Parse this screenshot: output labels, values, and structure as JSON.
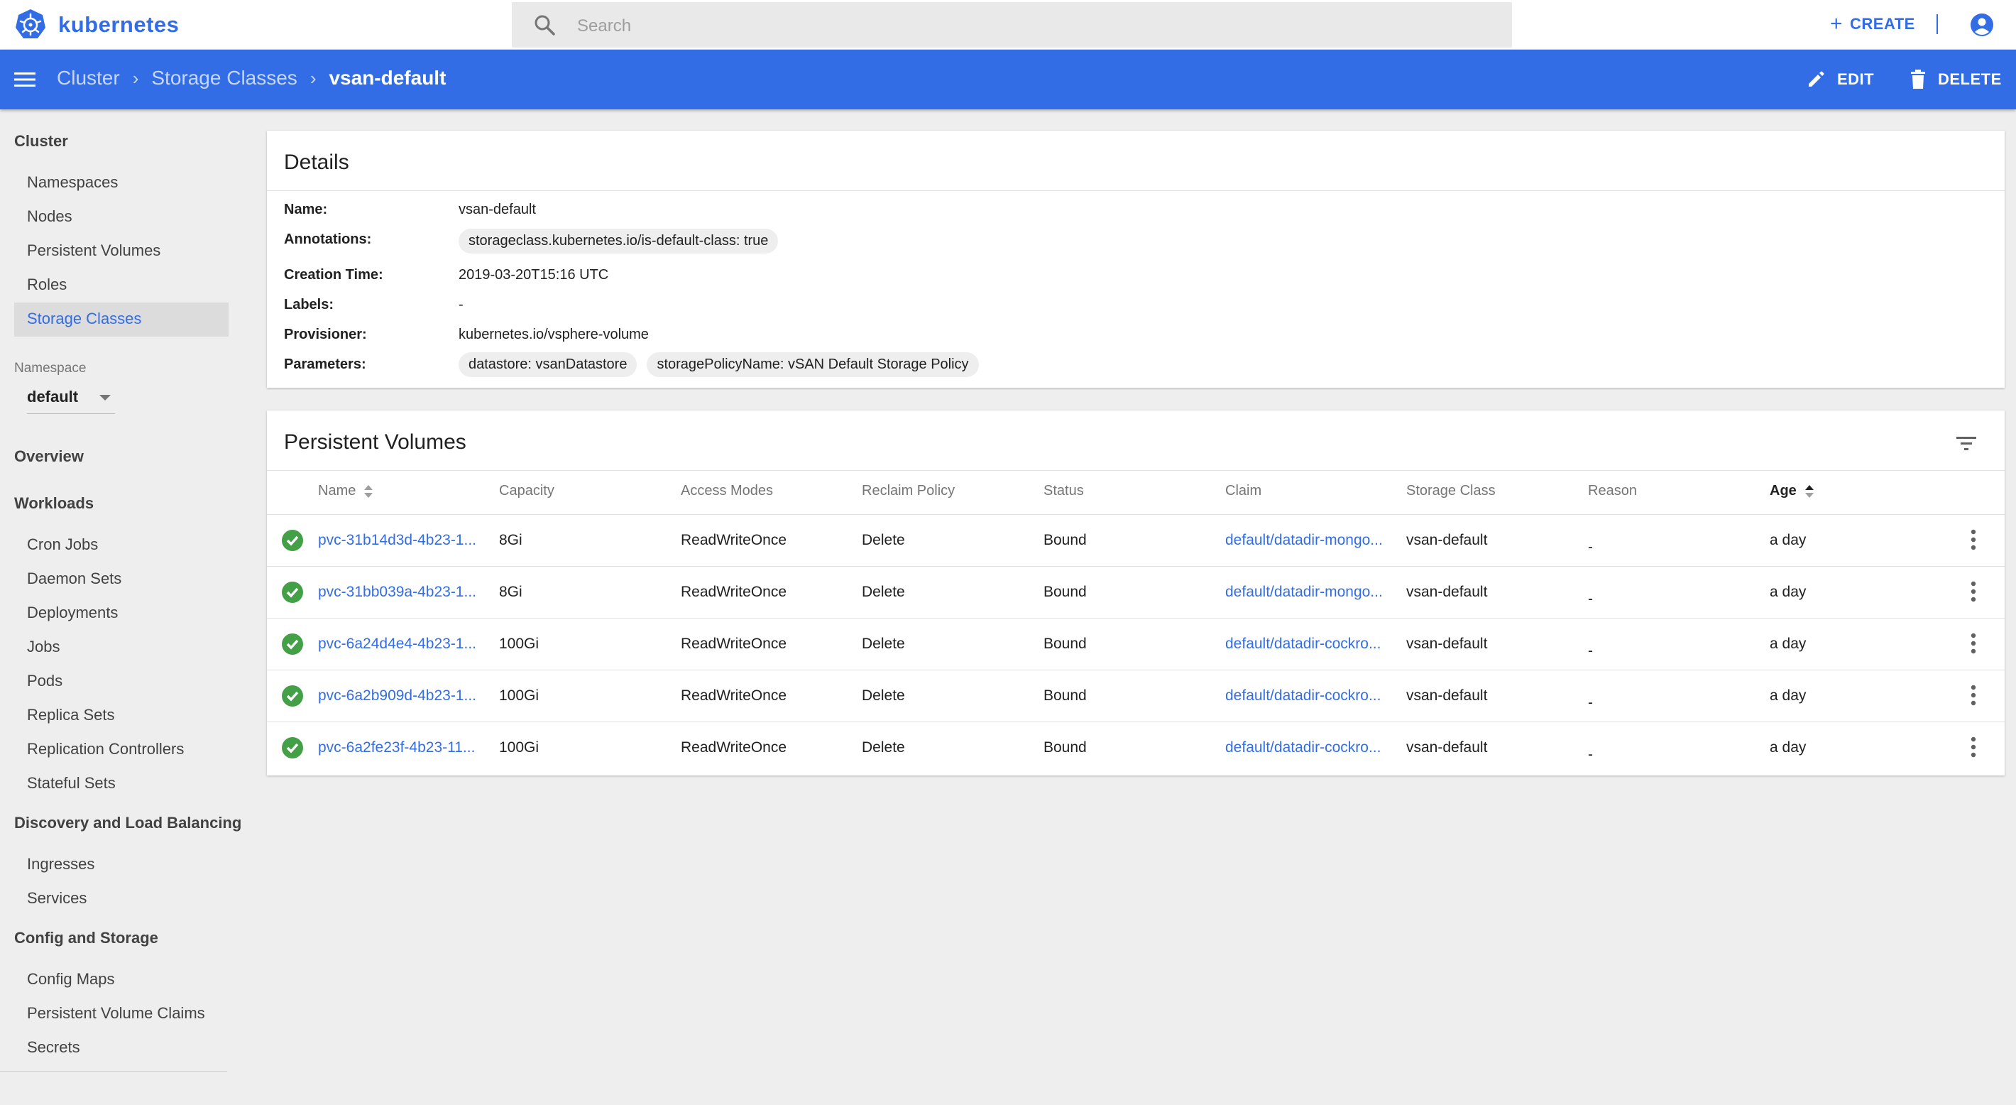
{
  "app": {
    "brand": "kubernetes"
  },
  "search": {
    "placeholder": "Search"
  },
  "topbar": {
    "create_label": "CREATE"
  },
  "breadcrumb": [
    "Cluster",
    "Storage Classes",
    "vsan-default"
  ],
  "header_actions": {
    "edit_label": "EDIT",
    "delete_label": "DELETE"
  },
  "sidebar": {
    "cluster_heading": "Cluster",
    "cluster_items": [
      "Namespaces",
      "Nodes",
      "Persistent Volumes",
      "Roles",
      "Storage Classes"
    ],
    "active_item": "Storage Classes",
    "namespace_label": "Namespace",
    "namespace_value": "default",
    "overview": "Overview",
    "workloads_heading": "Workloads",
    "workloads_items": [
      "Cron Jobs",
      "Daemon Sets",
      "Deployments",
      "Jobs",
      "Pods",
      "Replica Sets",
      "Replication Controllers",
      "Stateful Sets"
    ],
    "discovery_heading": "Discovery and Load Balancing",
    "discovery_items": [
      "Ingresses",
      "Services"
    ],
    "config_heading": "Config and Storage",
    "config_items": [
      "Config Maps",
      "Persistent Volume Claims",
      "Secrets"
    ]
  },
  "details": {
    "title": "Details",
    "name_label": "Name:",
    "name_value": "vsan-default",
    "annotations_label": "Annotations:",
    "annotations": [
      "storageclass.kubernetes.io/is-default-class:  true"
    ],
    "creation_label": "Creation Time:",
    "creation_value": "2019-03-20T15:16 UTC",
    "labels_label": "Labels:",
    "labels_value": "-",
    "provisioner_label": "Provisioner:",
    "provisioner_value": "kubernetes.io/vsphere-volume",
    "parameters_label": "Parameters:",
    "parameters": [
      "datastore: vsanDatastore",
      "storagePolicyName: vSAN Default Storage Policy"
    ]
  },
  "persistent_volumes": {
    "title": "Persistent Volumes",
    "columns": [
      "Name",
      "Capacity",
      "Access Modes",
      "Reclaim Policy",
      "Status",
      "Claim",
      "Storage Class",
      "Reason",
      "Age"
    ],
    "rows": [
      {
        "name": "pvc-31b14d3d-4b23-1...",
        "capacity": "8Gi",
        "access": "ReadWriteOnce",
        "reclaim": "Delete",
        "status": "Bound",
        "claim": "default/datadir-mongo...",
        "storage_class": "vsan-default",
        "reason": "-",
        "age": "a day"
      },
      {
        "name": "pvc-31bb039a-4b23-1...",
        "capacity": "8Gi",
        "access": "ReadWriteOnce",
        "reclaim": "Delete",
        "status": "Bound",
        "claim": "default/datadir-mongo...",
        "storage_class": "vsan-default",
        "reason": "-",
        "age": "a day"
      },
      {
        "name": "pvc-6a24d4e4-4b23-1...",
        "capacity": "100Gi",
        "access": "ReadWriteOnce",
        "reclaim": "Delete",
        "status": "Bound",
        "claim": "default/datadir-cockro...",
        "storage_class": "vsan-default",
        "reason": "-",
        "age": "a day"
      },
      {
        "name": "pvc-6a2b909d-4b23-1...",
        "capacity": "100Gi",
        "access": "ReadWriteOnce",
        "reclaim": "Delete",
        "status": "Bound",
        "claim": "default/datadir-cockro...",
        "storage_class": "vsan-default",
        "reason": "-",
        "age": "a day"
      },
      {
        "name": "pvc-6a2fe23f-4b23-11...",
        "capacity": "100Gi",
        "access": "ReadWriteOnce",
        "reclaim": "Delete",
        "status": "Bound",
        "claim": "default/datadir-cockro...",
        "storage_class": "vsan-default",
        "reason": "-",
        "age": "a day"
      }
    ]
  },
  "colors": {
    "accent": "#326de6",
    "success": "#43a047",
    "background": "#eeeeee"
  }
}
